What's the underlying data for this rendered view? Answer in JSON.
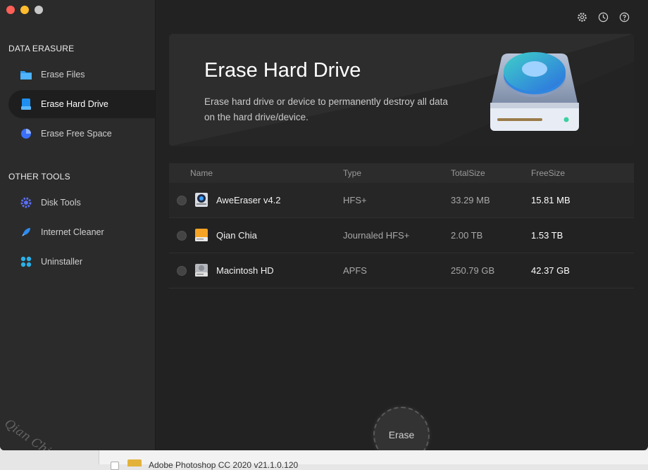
{
  "sidebar": {
    "section1_title": "DATA ERASURE",
    "section2_title": "OTHER TOOLS",
    "items": [
      {
        "label": "Erase Files",
        "icon": "folder-icon"
      },
      {
        "label": "Erase Hard Drive",
        "icon": "hard-drive-icon",
        "active": true
      },
      {
        "label": "Erase Free Space",
        "icon": "pie-chart-icon"
      },
      {
        "label": "Disk Tools",
        "icon": "gear-icon"
      },
      {
        "label": "Internet Cleaner",
        "icon": "rocket-icon"
      },
      {
        "label": "Uninstaller",
        "icon": "apps-grid-icon"
      }
    ],
    "watermark": "Qian Chia Soft"
  },
  "toolbar": {
    "icons": [
      "settings-icon",
      "history-icon",
      "help-icon"
    ]
  },
  "banner": {
    "title": "Erase Hard Drive",
    "description": "Erase hard drive or device to permanently destroy all data on the hard drive/device."
  },
  "table": {
    "headers": [
      "Name",
      "Type",
      "TotalSize",
      "FreeSize"
    ],
    "rows": [
      {
        "name": "AweEraser v4.2",
        "type": "HFS+",
        "total": "33.29 MB",
        "free": "15.81 MB",
        "icon": "disk-image-icon"
      },
      {
        "name": "Qian Chia",
        "type": "Journaled HFS+",
        "total": "2.00 TB",
        "free": "1.53 TB",
        "icon": "external-drive-icon"
      },
      {
        "name": "Macintosh HD",
        "type": "APFS",
        "total": "250.79 GB",
        "free": "42.37 GB",
        "icon": "internal-drive-icon"
      }
    ]
  },
  "erase_button": "Erase",
  "background_window": {
    "text": "Adobe Photoshop CC 2020 v21.1.0.120"
  },
  "colors": {
    "accent_blue": "#2d8cf0",
    "sidebar_bg": "#2b2b2b",
    "main_bg": "#222222"
  }
}
